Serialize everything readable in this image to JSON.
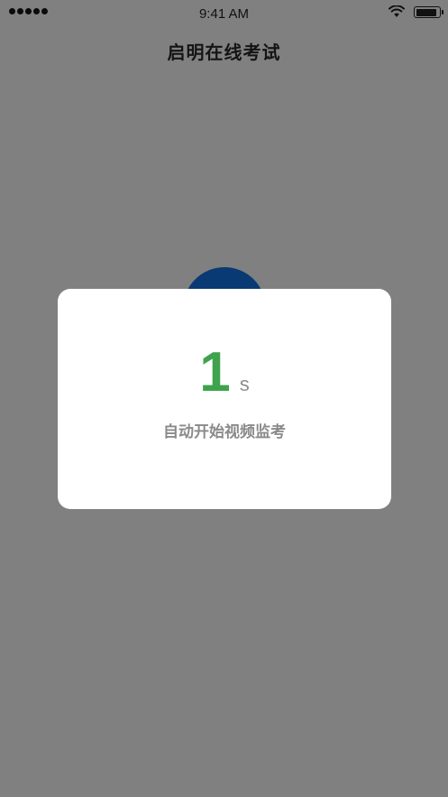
{
  "status_bar": {
    "time": "9:41 AM",
    "battery_level_percent": 90,
    "icons": [
      "signal-dots-icon",
      "wifi-icon",
      "battery-icon"
    ]
  },
  "header": {
    "title": "启明在线考试"
  },
  "modal": {
    "count": "1",
    "unit": "s",
    "message": "自动开始视频监考"
  },
  "colors": {
    "overlay": "#808080",
    "accent_green": "#3fa34d",
    "circle_blue": "#0a3a74",
    "muted_text": "#8a8a8a"
  }
}
